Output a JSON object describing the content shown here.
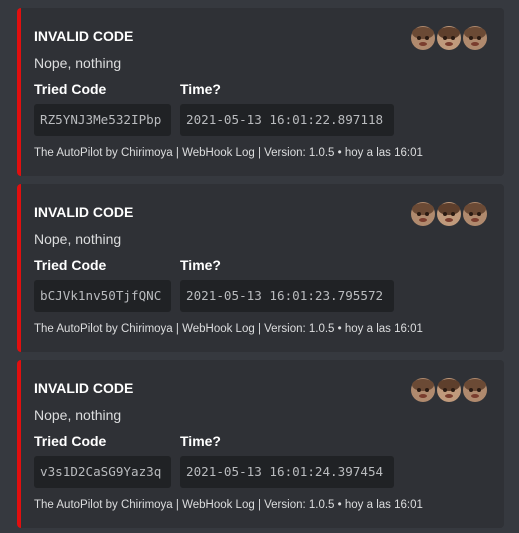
{
  "embeds": [
    {
      "title": "INVALID CODE",
      "description": "Nope, nothing",
      "fields": [
        {
          "name": "Tried Code",
          "value": "RZ5YNJ3Me532IPbp"
        },
        {
          "name": "Time?",
          "value": "2021-05-13 16:01:22.897118"
        }
      ],
      "footer": "The AutoPilot by Chirimoya | WebHook Log | Version: 1.0.5 • hoy a las 16:01"
    },
    {
      "title": "INVALID CODE",
      "description": "Nope, nothing",
      "fields": [
        {
          "name": "Tried Code",
          "value": "bCJVk1nv50TjfQNC"
        },
        {
          "name": "Time?",
          "value": "2021-05-13 16:01:23.795572"
        }
      ],
      "footer": "The AutoPilot by Chirimoya | WebHook Log | Version: 1.0.5 • hoy a las 16:01"
    },
    {
      "title": "INVALID CODE",
      "description": "Nope, nothing",
      "fields": [
        {
          "name": "Tried Code",
          "value": "v3s1D2CaSG9Yaz3q"
        },
        {
          "name": "Time?",
          "value": "2021-05-13 16:01:24.397454"
        }
      ],
      "footer": "The AutoPilot by Chirimoya | WebHook Log | Version: 1.0.5 • hoy a las 16:01"
    }
  ],
  "colors": {
    "background": "#36393f",
    "embed_background": "#2f3136",
    "embed_accent": "#e10f0f",
    "code_background": "#202225"
  },
  "icons": {
    "thumbnail": "emoji-faces-thumbnail-icon"
  }
}
